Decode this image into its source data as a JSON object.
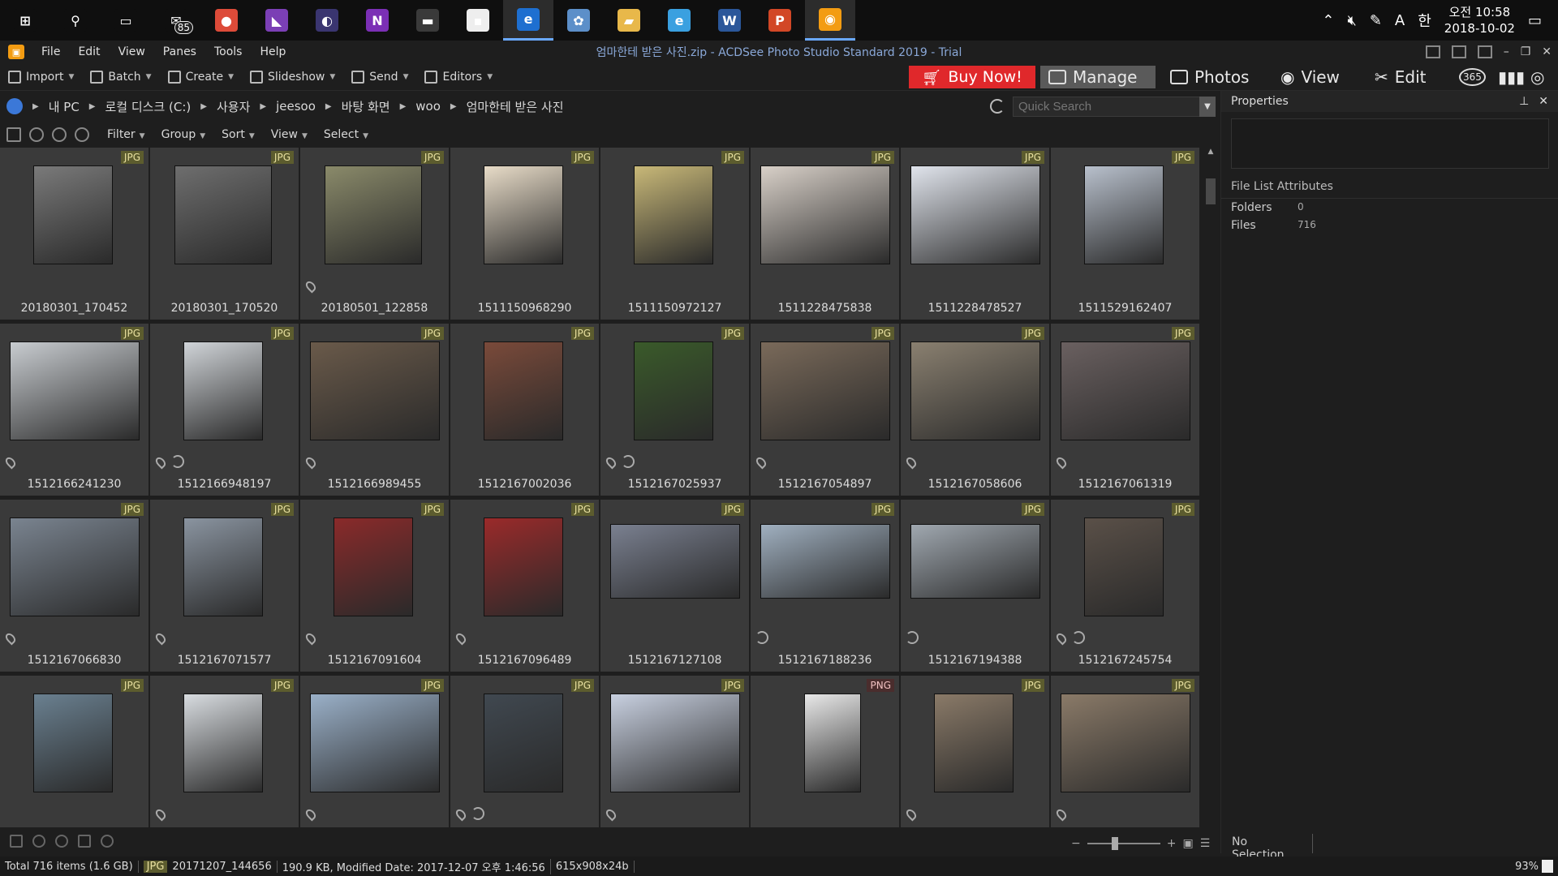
{
  "taskbar": {
    "apps": [
      {
        "name": "windows-start-icon",
        "glyph": "⊞",
        "color": "#0f0f0f"
      },
      {
        "name": "search-icon",
        "glyph": "⚲",
        "color": "#0f0f0f"
      },
      {
        "name": "task-view-icon",
        "glyph": "▭",
        "color": "#0f0f0f"
      },
      {
        "name": "mail-icon",
        "glyph": "✉",
        "color": "#0f0f0f",
        "badge": "85"
      },
      {
        "name": "chrome-icon",
        "glyph": "●",
        "color": "#dd4b39"
      },
      {
        "name": "visual-studio-icon",
        "glyph": "◣",
        "color": "#7b3fb5"
      },
      {
        "name": "eclipse-icon",
        "glyph": "◐",
        "color": "#3a3570"
      },
      {
        "name": "onenote-icon",
        "glyph": "N",
        "color": "#7b2fb5"
      },
      {
        "name": "terminal-icon",
        "glyph": "▬",
        "color": "#3a3a3a"
      },
      {
        "name": "sticky-notes-icon",
        "glyph": "▪",
        "color": "#eee"
      },
      {
        "name": "edge-icon",
        "glyph": "e",
        "color": "#1e6fd0",
        "active": true
      },
      {
        "name": "paint-icon",
        "glyph": "✿",
        "color": "#5c8fc9"
      },
      {
        "name": "file-explorer-icon",
        "glyph": "▰",
        "color": "#e8b84a"
      },
      {
        "name": "internet-explorer-icon",
        "glyph": "e",
        "color": "#3aa0e0"
      },
      {
        "name": "word-icon",
        "glyph": "W",
        "color": "#2b579a"
      },
      {
        "name": "powerpoint-icon",
        "glyph": "P",
        "color": "#d24726"
      },
      {
        "name": "acdsee-icon",
        "glyph": "◉",
        "color": "#f39c12",
        "active": true
      }
    ],
    "clock_time": "오전 10:58",
    "clock_date": "2018-10-02",
    "ime_a": "A",
    "ime_han": "한"
  },
  "menubar": {
    "title": "엄마한테 받은 사진.zip - ACDSee Photo Studio Standard 2019 - Trial",
    "items": [
      "File",
      "Edit",
      "View",
      "Panes",
      "Tools",
      "Help"
    ]
  },
  "toolbar": {
    "tools": [
      "Import",
      "Batch",
      "Create",
      "Slideshow",
      "Send",
      "Editors"
    ],
    "buy_label": "Buy Now!",
    "modes": [
      "Manage",
      "Photos",
      "View",
      "Edit"
    ],
    "mode_365": "365"
  },
  "address": {
    "crumbs": [
      "내 PC",
      "로컬 디스크 (C:)",
      "사용자",
      "jeesoo",
      "바탕 화면",
      "woo",
      "엄마한테 받은 사진"
    ],
    "search_placeholder": "Quick Search"
  },
  "filters": [
    "Filter",
    "Group",
    "Sort",
    "View",
    "Select"
  ],
  "thumbnails": [
    {
      "name": "20180301_170452",
      "type": "JPG",
      "tone": "#7a7a7a",
      "orient": "p"
    },
    {
      "name": "20180301_170520",
      "type": "JPG",
      "tone": "#6e6e6e",
      "orient": "s"
    },
    {
      "name": "20180501_122858",
      "type": "JPG",
      "tone": "#8a8a6a",
      "orient": "s",
      "pin": true
    },
    {
      "name": "1511150968290",
      "type": "JPG",
      "tone": "#e8dcc8",
      "orient": "p"
    },
    {
      "name": "1511150972127",
      "type": "JPG",
      "tone": "#c8b878",
      "orient": "p"
    },
    {
      "name": "1511228475838",
      "type": "JPG",
      "tone": "#d8d0c8",
      "orient": "l"
    },
    {
      "name": "1511228478527",
      "type": "JPG",
      "tone": "#e0e4ec",
      "orient": "l"
    },
    {
      "name": "1511529162407",
      "type": "JPG",
      "tone": "#b8c0cc",
      "orient": "p"
    },
    {
      "name": "1512166241230",
      "type": "JPG",
      "tone": "#c8ccd0",
      "orient": "l",
      "pin": true
    },
    {
      "name": "1512166948197",
      "type": "JPG",
      "tone": "#d0d4d8",
      "orient": "p",
      "pin": true,
      "sync": true
    },
    {
      "name": "1512166989455",
      "type": "JPG",
      "tone": "#6a5a4a",
      "orient": "l",
      "pin": true
    },
    {
      "name": "1512167002036",
      "type": "JPG",
      "tone": "#7a4a3a",
      "orient": "p"
    },
    {
      "name": "1512167025937",
      "type": "JPG",
      "tone": "#3a5a2a",
      "orient": "p",
      "pin": true,
      "sync": true
    },
    {
      "name": "1512167054897",
      "type": "JPG",
      "tone": "#7a6a5a",
      "orient": "l",
      "pin": true
    },
    {
      "name": "1512167058606",
      "type": "JPG",
      "tone": "#8a8070",
      "orient": "l",
      "pin": true
    },
    {
      "name": "1512167061319",
      "type": "JPG",
      "tone": "#6a6060",
      "orient": "l",
      "pin": true
    },
    {
      "name": "1512167066830",
      "type": "JPG",
      "tone": "#7a8490",
      "orient": "l",
      "pin": true
    },
    {
      "name": "1512167071577",
      "type": "JPG",
      "tone": "#8a94a0",
      "orient": "p",
      "pin": true
    },
    {
      "name": "1512167091604",
      "type": "JPG",
      "tone": "#8a2a2a",
      "orient": "p",
      "pin": true
    },
    {
      "name": "1512167096489",
      "type": "JPG",
      "tone": "#9a2a2a",
      "orient": "p",
      "pin": true
    },
    {
      "name": "1512167127108",
      "type": "JPG",
      "tone": "#7a8090",
      "orient": "w"
    },
    {
      "name": "1512167188236",
      "type": "JPG",
      "tone": "#a0b0c0",
      "orient": "w",
      "sync_only": true
    },
    {
      "name": "1512167194388",
      "type": "JPG",
      "tone": "#a0a8b0",
      "orient": "w",
      "sync_only": true
    },
    {
      "name": "1512167245754",
      "type": "JPG",
      "tone": "#5a5048",
      "orient": "p",
      "pin": true,
      "sync": true
    },
    {
      "name": "",
      "type": "JPG",
      "tone": "#6a8090",
      "orient": "p"
    },
    {
      "name": "",
      "type": "JPG",
      "tone": "#d8dce0",
      "orient": "p",
      "pin": true
    },
    {
      "name": "",
      "type": "JPG",
      "tone": "#9ab0c8",
      "orient": "l",
      "pin": true
    },
    {
      "name": "",
      "type": "JPG",
      "tone": "#404850",
      "orient": "p",
      "pin": true,
      "sync": true
    },
    {
      "name": "",
      "type": "JPG",
      "tone": "#c8d0e0",
      "orient": "l",
      "pin": true
    },
    {
      "name": "",
      "type": "PNG",
      "tone": "#e8e8e8",
      "orient": "n"
    },
    {
      "name": "",
      "type": "JPG",
      "tone": "#8a7a68",
      "orient": "p",
      "pin": true
    },
    {
      "name": "",
      "type": "JPG",
      "tone": "#8a7a68",
      "orient": "l",
      "pin": true
    }
  ],
  "properties": {
    "title": "Properties",
    "section": "File List Attributes",
    "folders_label": "Folders",
    "folders_value": "0",
    "files_label": "Files",
    "files_value": "716",
    "no_selection": "No Selection"
  },
  "status": {
    "total": "Total 716 items  (1.6 GB)",
    "type": "JPG",
    "file": "20171207_144656",
    "info": "190.9 KB, Modified Date: 2017-12-07 오후 1:46:56",
    "dims": "615x908x24b",
    "zoom": "93%"
  }
}
